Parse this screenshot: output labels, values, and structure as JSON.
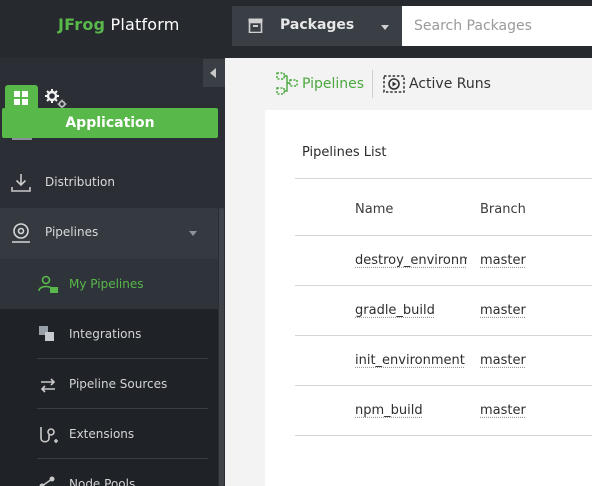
{
  "header": {
    "logo_brand": "JFrog",
    "logo_product": "Platform",
    "packages_label": "Packages",
    "search_placeholder": "Search Packages"
  },
  "sidebar": {
    "app_tooltip": "Application",
    "items": [
      {
        "label": "Distribution",
        "icon": "download-icon"
      },
      {
        "label": "Pipelines",
        "icon": "pipelines-icon"
      }
    ],
    "sub_items": [
      {
        "label": "My Pipelines",
        "icon": "my-pipelines-icon",
        "active": true
      },
      {
        "label": "Integrations",
        "icon": "integrations-icon"
      },
      {
        "label": "Pipeline Sources",
        "icon": "pipeline-sources-icon"
      },
      {
        "label": "Extensions",
        "icon": "extensions-icon"
      },
      {
        "label": "Node Pools",
        "icon": "node-pools-icon"
      }
    ]
  },
  "main": {
    "tabs": [
      {
        "label": "Pipelines",
        "active": true
      },
      {
        "label": "Active Runs",
        "active": false
      }
    ],
    "list_title": "Pipelines List",
    "columns": [
      "Name",
      "Branch"
    ],
    "rows": [
      {
        "name": "destroy_environment",
        "branch": "master"
      },
      {
        "name": "gradle_build",
        "branch": "master"
      },
      {
        "name": "init_environment",
        "branch": "master"
      },
      {
        "name": "npm_build",
        "branch": "master"
      }
    ]
  },
  "colors": {
    "accent": "#58b84a",
    "topbar": "#26292e",
    "sidebar": "#2b2f35"
  }
}
